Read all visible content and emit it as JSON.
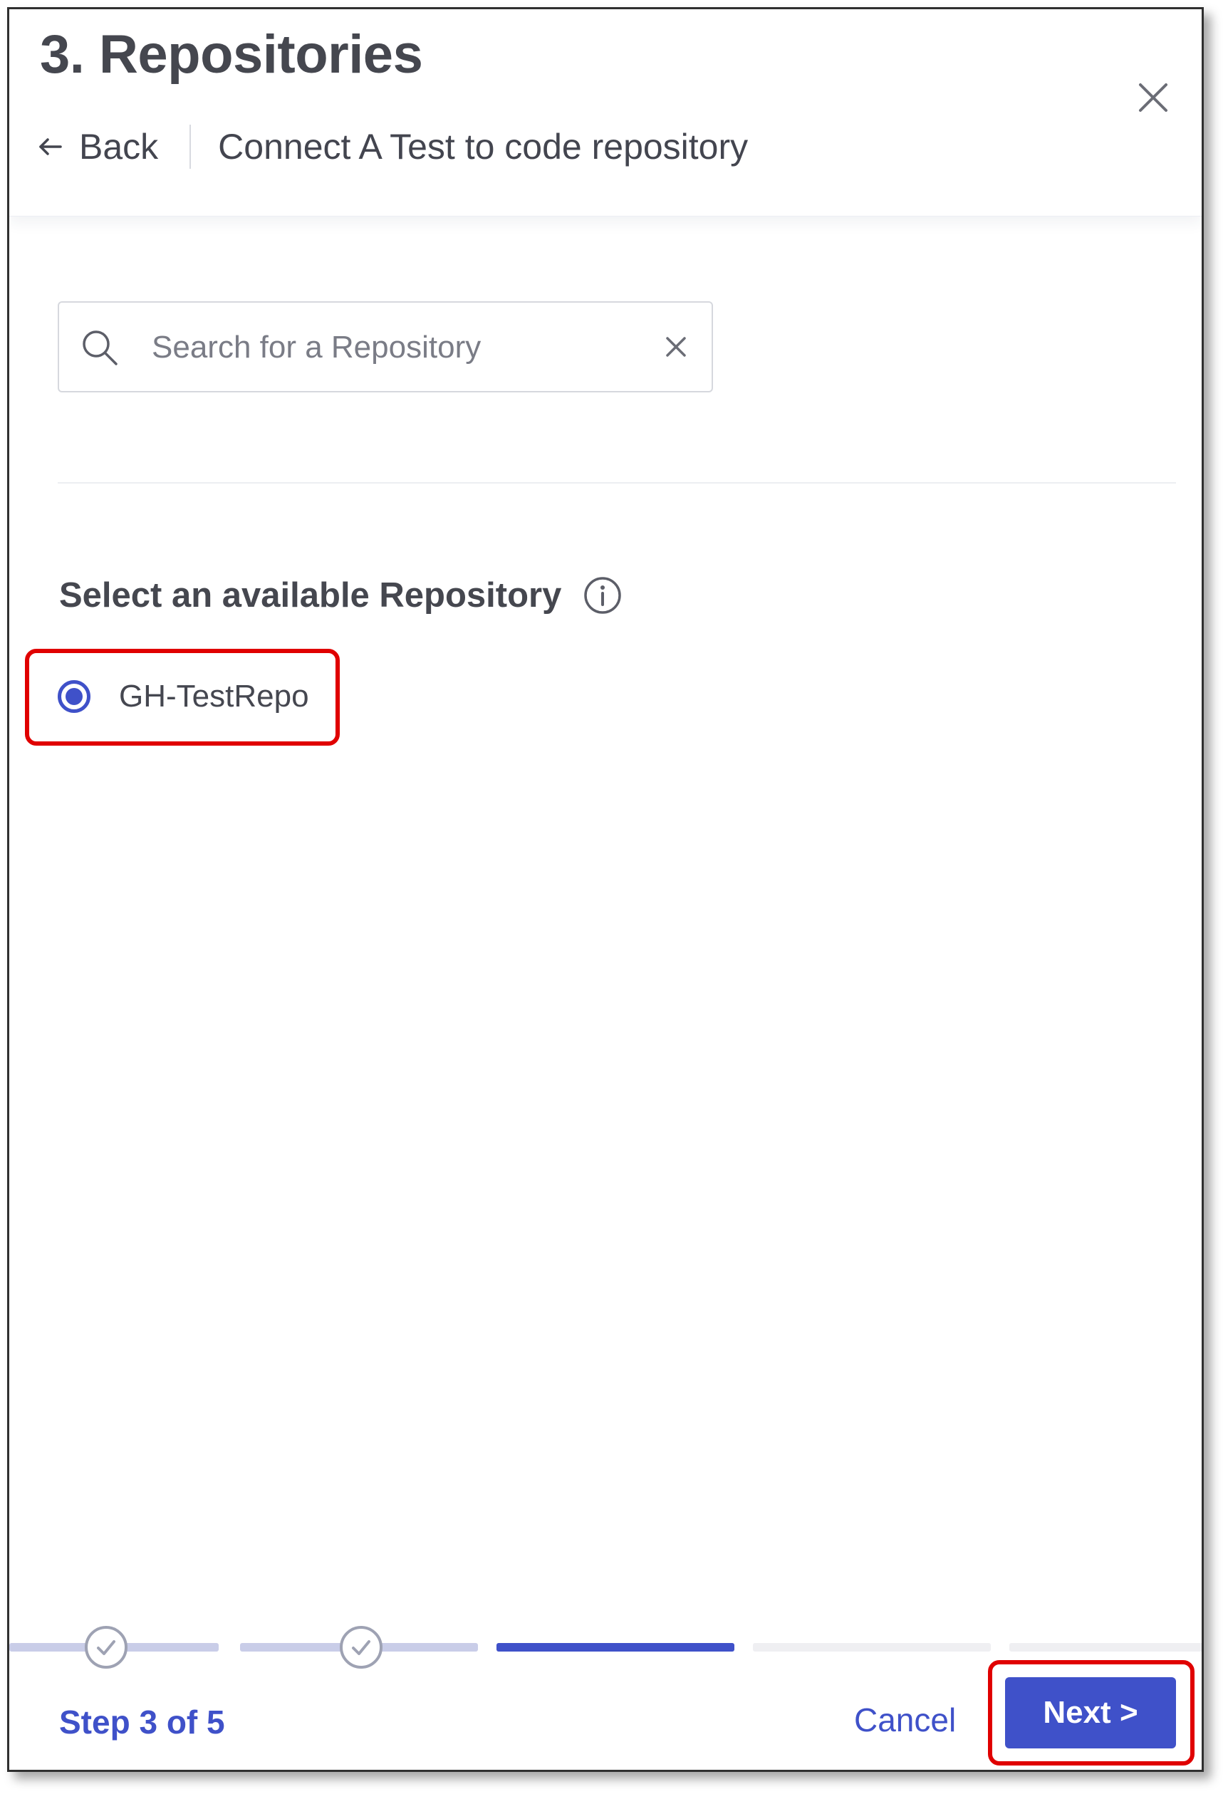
{
  "header": {
    "title": "3. Repositories",
    "back_label": "Back",
    "subtitle": "Connect A Test to code repository"
  },
  "search": {
    "placeholder": "Search for a Repository",
    "value": ""
  },
  "section": {
    "label": "Select an available Repository"
  },
  "repositories": [
    {
      "name": "GH-TestRepo",
      "selected": true
    }
  ],
  "footer": {
    "step_text": "Step 3 of 5",
    "cancel_label": "Cancel",
    "next_label": "Next >"
  },
  "stepper": {
    "current": 3,
    "total": 5,
    "states": [
      "done",
      "done",
      "active",
      "todo",
      "todo"
    ]
  },
  "colors": {
    "accent": "#3f51c9",
    "highlight": "#e00000",
    "completed_step": "#c9cde8",
    "pending_step": "#efeff2"
  },
  "icons": {
    "close": "close-icon",
    "back": "arrow-left-icon",
    "search": "search-icon",
    "clear": "clear-icon",
    "info": "info-icon",
    "step_done": "check-circle-icon"
  }
}
